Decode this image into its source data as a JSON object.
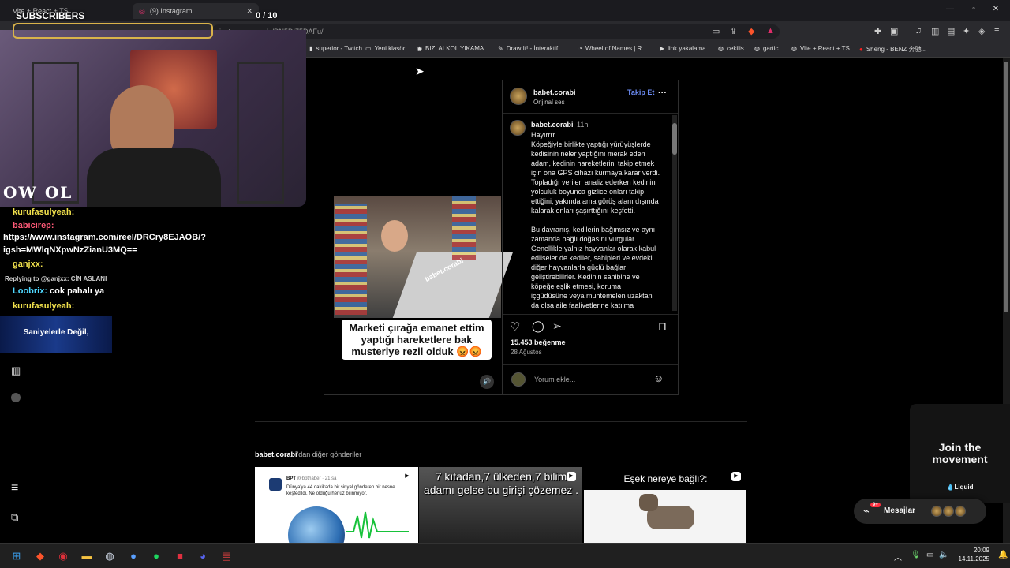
{
  "stream": {
    "subscribers_label": "SUBSCRIBERS",
    "sub_count": "0 / 10",
    "cam_sign": "OW OL",
    "chat": [
      {
        "user": "kurufasulyeah:",
        "color": "#f0e04c",
        "text": ""
      },
      {
        "user": "babicirep:",
        "color": "#ff5a78",
        "text": ""
      },
      {
        "user": "",
        "color": "#ffffff",
        "text": "https://www.instagram.com/reel/DRCry8EJAOB/?"
      },
      {
        "user": "",
        "color": "#ffffff",
        "text": "igsh=MWlqNXpwNzZianU3MQ=="
      },
      {
        "user": "ganjxx:",
        "color": "#f0e04c",
        "text": ""
      },
      {
        "user": "",
        "color": "#d0d0d0",
        "text": "Replying to @ganjxx: CİN ASLANI"
      },
      {
        "user": "Loobrix:",
        "color": "#4fd8ff",
        "text": " cok pahalı ya"
      },
      {
        "user": "kurufasulyeah:",
        "color": "#f0e04c",
        "text": ""
      }
    ],
    "banner_text": "Saniyelerle Değil,"
  },
  "browser": {
    "tab1_title": "Vite + React + TS",
    "tab2_title": "(9) Instagram",
    "url": "instagram.com/p/DN5DI75DAFu/",
    "bookmarks": [
      {
        "label": "superior - Twitch",
        "icon": "twitch-icon"
      },
      {
        "label": "Yeni klasör",
        "icon": "folder-icon"
      },
      {
        "label": "BIZI ALKOL YIKAMA...",
        "icon": "site-icon"
      },
      {
        "label": "Draw It! - İnteraktif...",
        "icon": "pencil-icon"
      },
      {
        "label": "Wheel of Names | R...",
        "icon": "wheel-icon"
      },
      {
        "label": "link yakalama",
        "icon": "play-icon"
      },
      {
        "label": "cekilis",
        "icon": "globe-icon"
      },
      {
        "label": "gartic",
        "icon": "globe-icon"
      },
      {
        "label": "Vite + React + TS",
        "icon": "globe-icon"
      },
      {
        "label": "Sheng - BENZ 奔驰...",
        "icon": "youtube-icon"
      }
    ]
  },
  "post": {
    "username": "babet.corabi",
    "follow_label": "Takip Et",
    "audio": "Orijinal ses",
    "time_ago": "11h",
    "caption_lines": [
      "Hayırrrr",
      "Köpeğiyle birlikte yaptığı yürüyüşlerde",
      "kedisinin neler yaptığını merak eden",
      "adam, kedinin hareketlerini takip etmek",
      "için ona GPS cihazı kurmaya karar verdi.",
      "Topladığı verileri analiz ederken kedinin",
      "yolculuk boyunca gizlice onları takip",
      "ettiğini, yakında ama görüş alanı dışında",
      "kalarak onları şaşırttığını keşfetti.",
      "",
      "Bu davranış, kedilerin bağımsız ve aynı",
      "zamanda bağlı doğasını vurgular.",
      "Genellikle yalnız hayvanlar olarak kabul",
      "edilseler de kediler, sahipleri ve evdeki",
      "diğer hayvanlarla güçlü bağlar",
      "geliştirebilirler. Kedinin sahibine ve",
      "köpeğe eşlik etmesi, koruma",
      "içgüdüsüne veya muhtemelen uzaktan",
      "da olsa aile faaliyetlerine katılma"
    ],
    "video_caption": "Marketi çırağa emanet ettim yaptığı hareketlere bak musteriye rezil olduk 😡😡",
    "watermark": "babet.corabi",
    "likes": "15.453 beğenme",
    "date": "28 Ağustos",
    "comment_placeholder": "Yorum ekle...",
    "more_from_user": "babet.corabi",
    "more_from_suffix": "'dan diğer gönderiler"
  },
  "more_posts": [
    {
      "title": "BPT",
      "handle": "@bpthaber · 21 sa",
      "text": "Dünya'ya 44 dakikada bir sinyal gönderen bir nesne keşfedildi. Ne olduğu henüz bilinmiyor."
    },
    {
      "title": "7 kıtadan,7 ülkeden,7 bilim adamı gelse bu girişi çözemez ."
    },
    {
      "title": "Eşek nereye bağlı?:"
    }
  ],
  "promo": {
    "headline": "Join the movement",
    "brand": "Liquid"
  },
  "messages": {
    "label": "Mesajlar",
    "badge": "9+"
  },
  "taskbar": {
    "time": "20:09",
    "date": "14.11.2025"
  }
}
